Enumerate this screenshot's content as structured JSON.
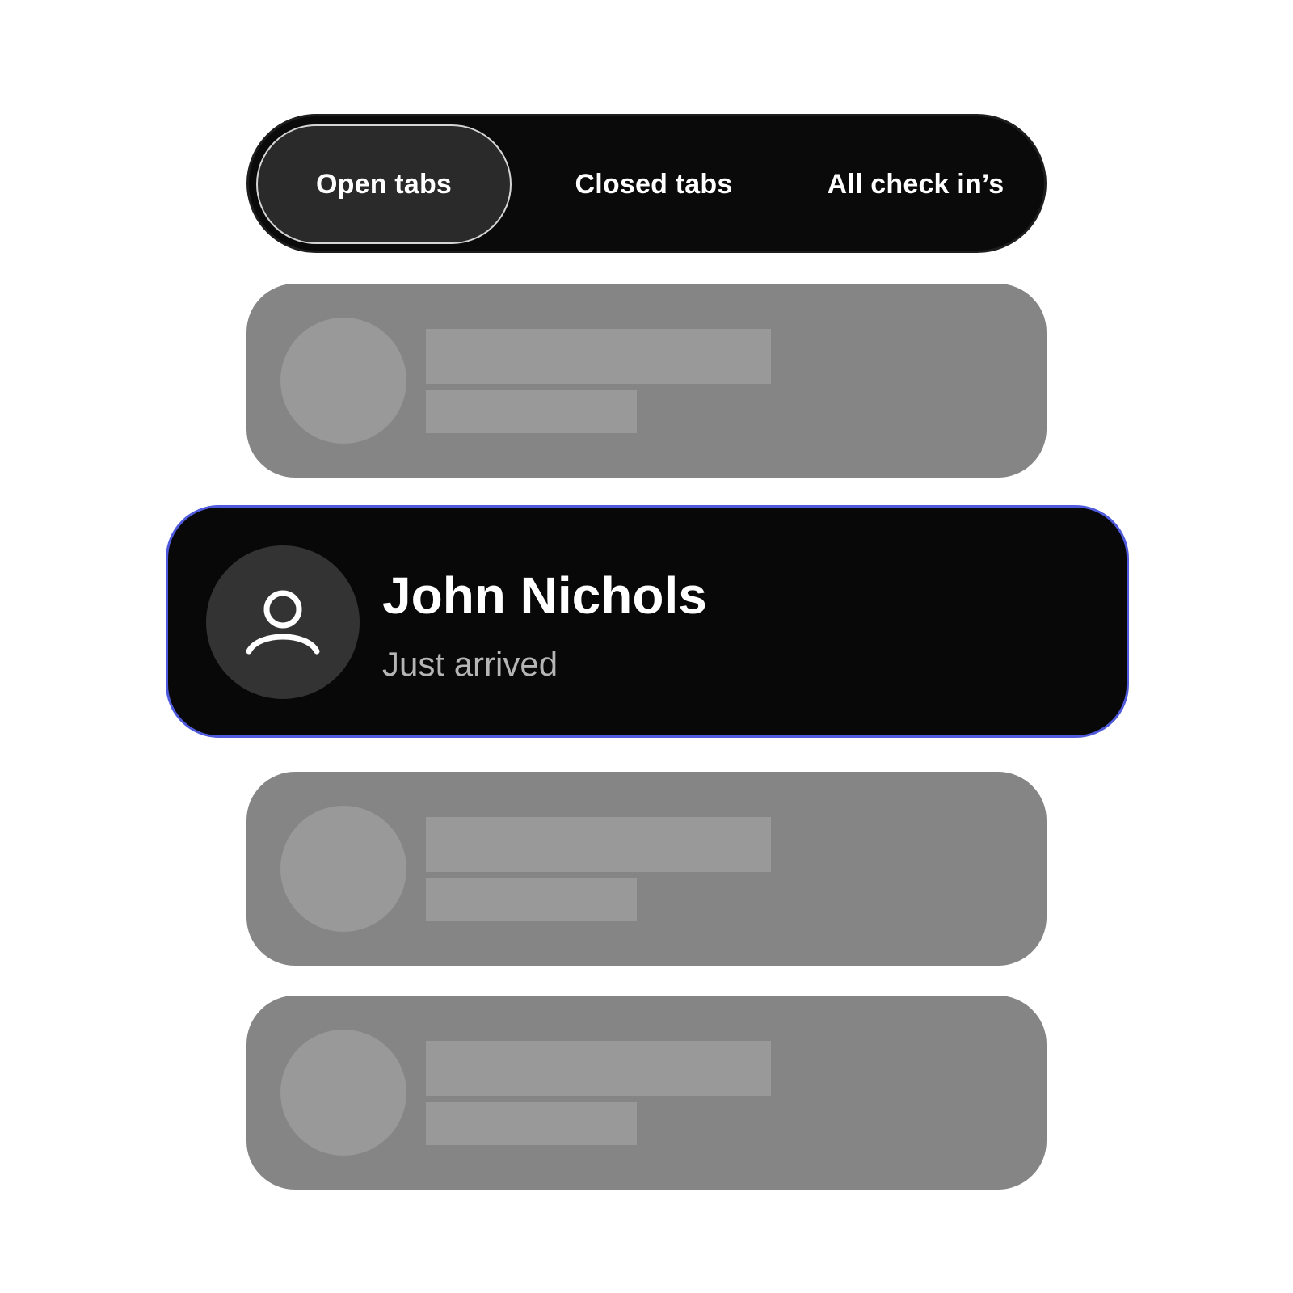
{
  "tabs": {
    "items": [
      {
        "label": "Open tabs",
        "active": true
      },
      {
        "label": "Closed tabs",
        "active": false
      },
      {
        "label": "All check in’s",
        "active": false
      }
    ]
  },
  "guest_card": {
    "name": "John Nichols",
    "status": "Just arrived",
    "avatar_icon": "user-icon",
    "highlight_color": "#4f5bdc"
  },
  "skeleton_rows": 3,
  "colors": {
    "tabbar_bg": "#0a0a0a",
    "active_tab_bg": "#2a2a2a",
    "skeleton_card": "#858585",
    "skeleton_block": "#999999",
    "card_bg": "#080808"
  }
}
